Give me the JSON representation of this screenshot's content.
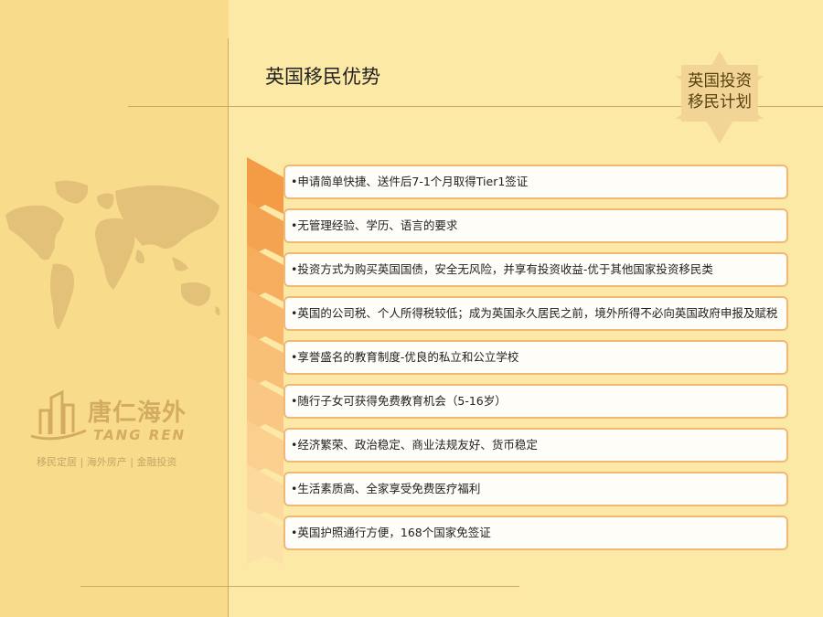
{
  "slide": {
    "title": "英国移民优势",
    "badge_line1": "英国投资",
    "badge_line2": "移民计划"
  },
  "logo": {
    "name_cn": "唐仁海外",
    "name_en": "TANG REN",
    "tagline": "移民定居 | 海外房产 | 金融投资"
  },
  "colors": {
    "background": "#fde9a6",
    "left_panel": "#f8dc8c",
    "chevron_dark": "#f39b45",
    "chevron_light": "#fde2a8",
    "box_border": "#f1b776",
    "badge_star": "#f2d596"
  },
  "advantages": [
    {
      "text": "•申请简单快捷、送件后7-1个月取得Tier1签证"
    },
    {
      "text": "•无管理经验、学历、语言的要求"
    },
    {
      "text": "•投资方式为购买英国国债，安全无风险，并享有投资收益-优于其他国家投资移民类"
    },
    {
      "text": "•英国的公司税、个人所得税较低；成为英国永久居民之前，境外所得不必向英国政府申报及赋税"
    },
    {
      "text": "•享誉盛名的教育制度-优良的私立和公立学校"
    },
    {
      "text": "•随行子女可获得免费教育机会（5-16岁）"
    },
    {
      "text": "•经济繁荣、政治稳定、商业法规友好、货币稳定"
    },
    {
      "text": "•生活素质高、全家享受免费医疗福利"
    },
    {
      "text": "•英国护照通行方便，168个国家免签证"
    }
  ]
}
